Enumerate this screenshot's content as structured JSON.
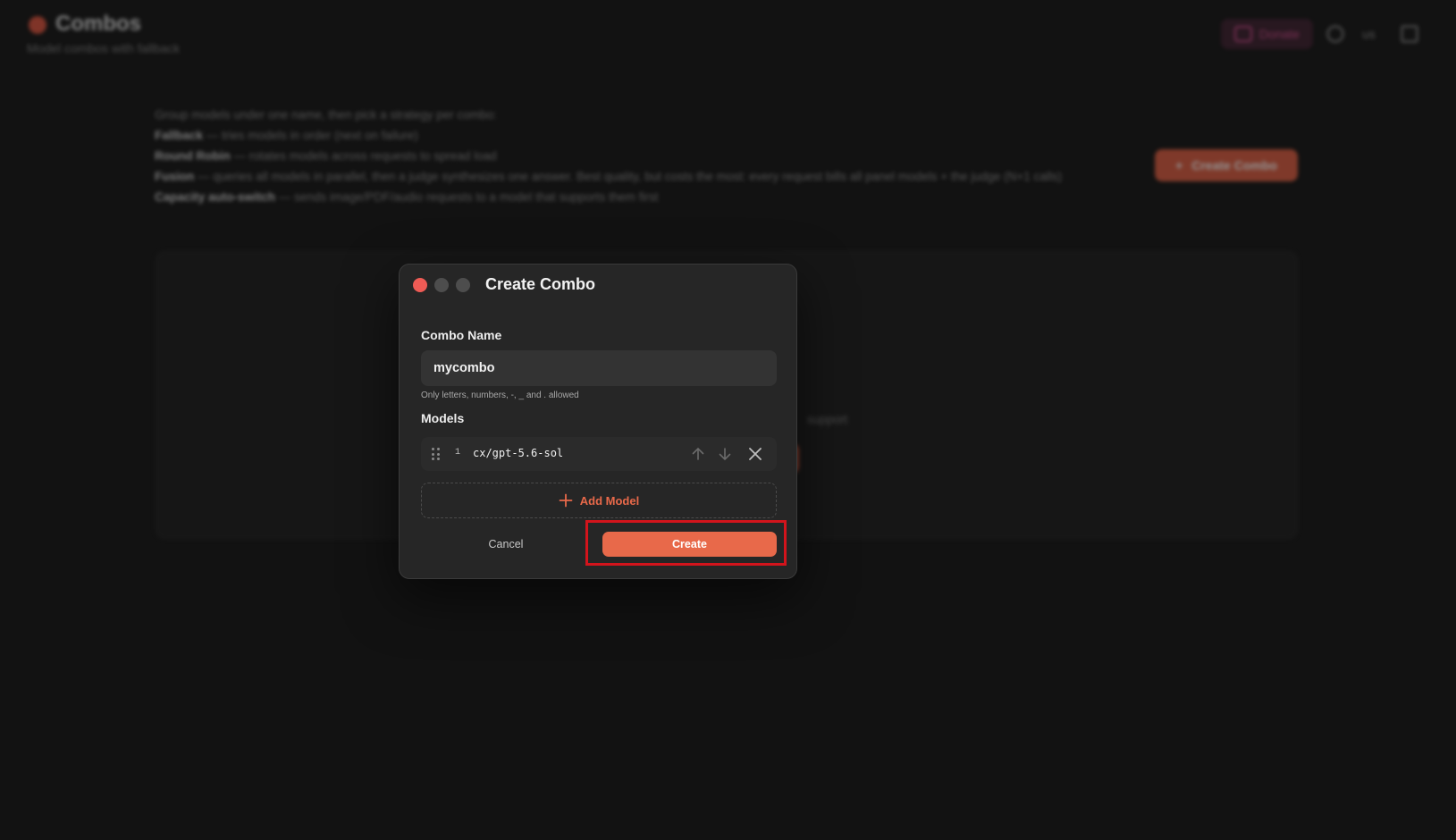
{
  "header": {
    "title": "Combos",
    "subtitle": "Model combos with fallback",
    "donate_label": "Donate",
    "language": "us"
  },
  "intro": {
    "summary": "Group models under one name, then pick a strategy per combo:",
    "strategies": [
      {
        "name": "Fallback",
        "desc": "— tries models in order (next on failure)"
      },
      {
        "name": "Round Robin",
        "desc": "— rotates models across requests to spread load"
      },
      {
        "name": "Fusion",
        "desc": "— queries all models in parallel, then a judge synthesizes one answer. Best quality, but costs the most: every request bills all panel models + the judge (N+1 calls)"
      },
      {
        "name": "Capacity auto-switch",
        "desc": "— sends image/PDF/audio requests to a model that supports them first"
      }
    ],
    "create_combo_label": "Create Combo",
    "peek_text": "support"
  },
  "modal": {
    "title": "Create Combo",
    "name_label": "Combo Name",
    "name_value": "mycombo",
    "name_hint": "Only letters, numbers, -, _ and . allowed",
    "models_label": "Models",
    "models": [
      {
        "index": "1",
        "name": "cx/gpt-5.6-sol"
      }
    ],
    "add_model_label": "Add Model",
    "cancel_label": "Cancel",
    "create_label": "Create"
  },
  "colors": {
    "accent": "#e8694a",
    "highlight": "#d3141c",
    "close_dot": "#ee5b55"
  },
  "icons": [
    "drag-handle-icon",
    "arrow-up-icon",
    "arrow-down-icon",
    "close-icon",
    "plus-icon"
  ]
}
